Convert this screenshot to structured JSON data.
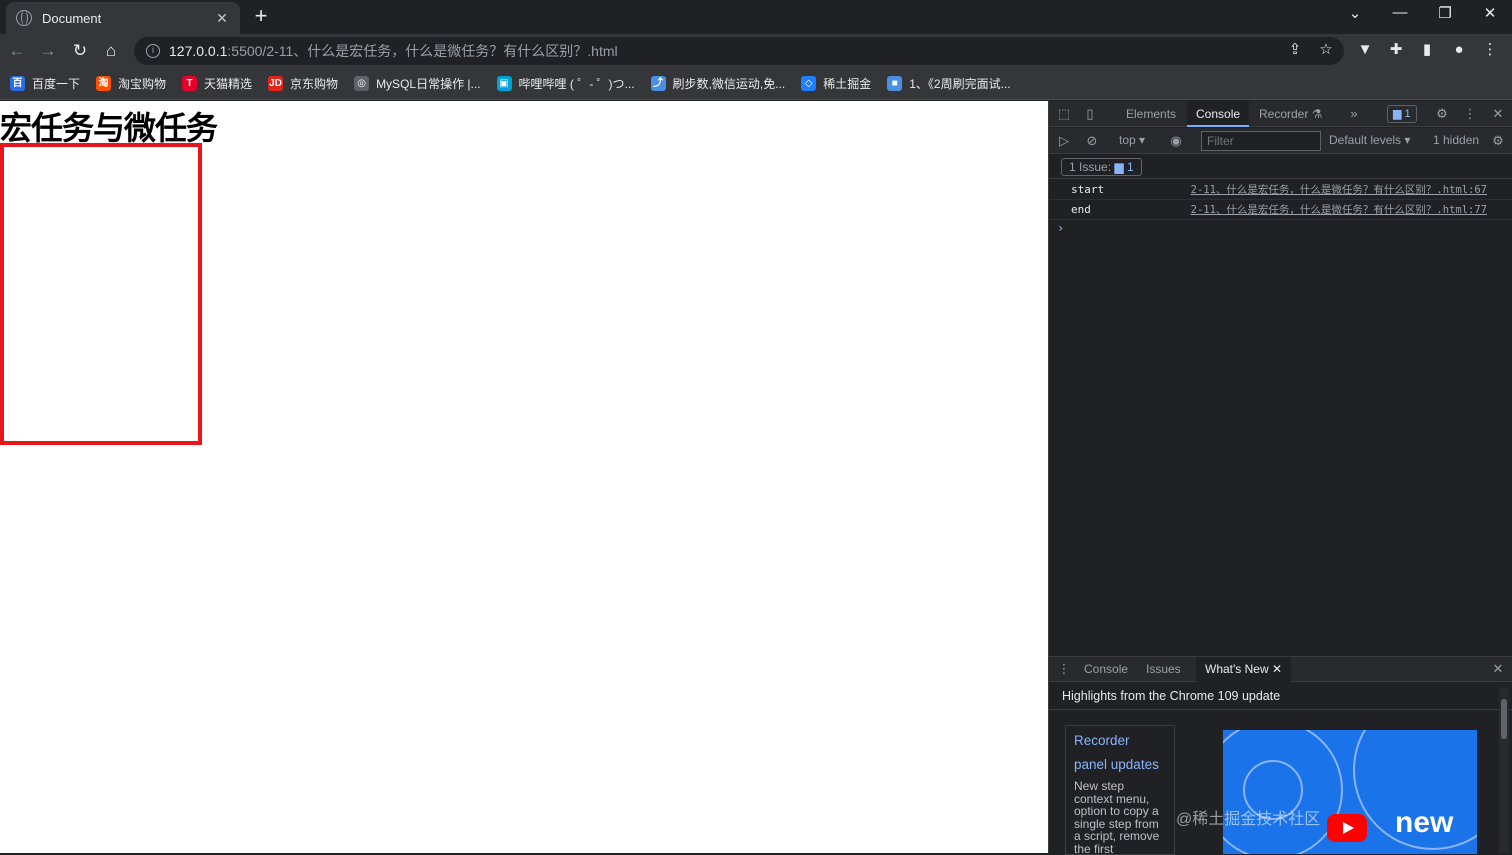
{
  "browser": {
    "tab_title": "Document",
    "url_host": "127.0.0.1",
    "url_path": ":5500/2-11、什么是宏任务，什么是微任务？有什么区别？.html"
  },
  "bookmarks": [
    {
      "label": "百度一下",
      "icon": "baidu-icon",
      "color": "#2b6de5",
      "glyph": "百"
    },
    {
      "label": "淘宝购物",
      "icon": "taobao-icon",
      "color": "#ff5000",
      "glyph": "淘"
    },
    {
      "label": "天猫精选",
      "icon": "tmall-icon",
      "color": "#e4002b",
      "glyph": "T"
    },
    {
      "label": "京东购物",
      "icon": "jd-icon",
      "color": "#e1251b",
      "glyph": "JD"
    },
    {
      "label": "MySQL日常操作 |...",
      "icon": "globe-icon",
      "color": "#5f6368",
      "glyph": "◎"
    },
    {
      "label": "哔哩哔哩 ( ゜- ゜)つ...",
      "icon": "bilibili-icon",
      "color": "#00a1d6",
      "glyph": "▣"
    },
    {
      "label": "刷步数,微信运动,免...",
      "icon": "run-icon",
      "color": "#4a90e2",
      "glyph": "⤴"
    },
    {
      "label": "稀土掘金",
      "icon": "juejin-icon",
      "color": "#1e80ff",
      "glyph": "◇"
    },
    {
      "label": "1、《2周刷完面试...",
      "icon": "doc-icon",
      "color": "#4a90e2",
      "glyph": "■"
    }
  ],
  "page": {
    "heading": "宏任务与微任务",
    "box_border_color": "#e6161c"
  },
  "devtools": {
    "tabs": [
      "Elements",
      "Console",
      "Recorder"
    ],
    "active_tab": "Console",
    "issues_badge": "1",
    "context": "top",
    "filter_placeholder": "Filter",
    "levels": "Default levels",
    "hidden": "1 hidden",
    "issue_label": "1 Issue:",
    "issue_count": "1",
    "logs": [
      {
        "message": "start",
        "source": "2-11、什么是宏任务，什么是微任务？有什么区别？.html:67"
      },
      {
        "message": "end",
        "source": "2-11、什么是宏任务，什么是微任务？有什么区别？.html:77"
      }
    ],
    "drawer": {
      "tabs": [
        "Console",
        "Issues",
        "What's New"
      ],
      "active": "What's New",
      "headline": "Highlights from the Chrome 109 update",
      "card_title": "Recorder panel updates",
      "card_body": "New step context menu, option to copy a single step from a script, remove the first",
      "video_text": "new"
    },
    "watermark": "@稀土掘金技术社区"
  }
}
